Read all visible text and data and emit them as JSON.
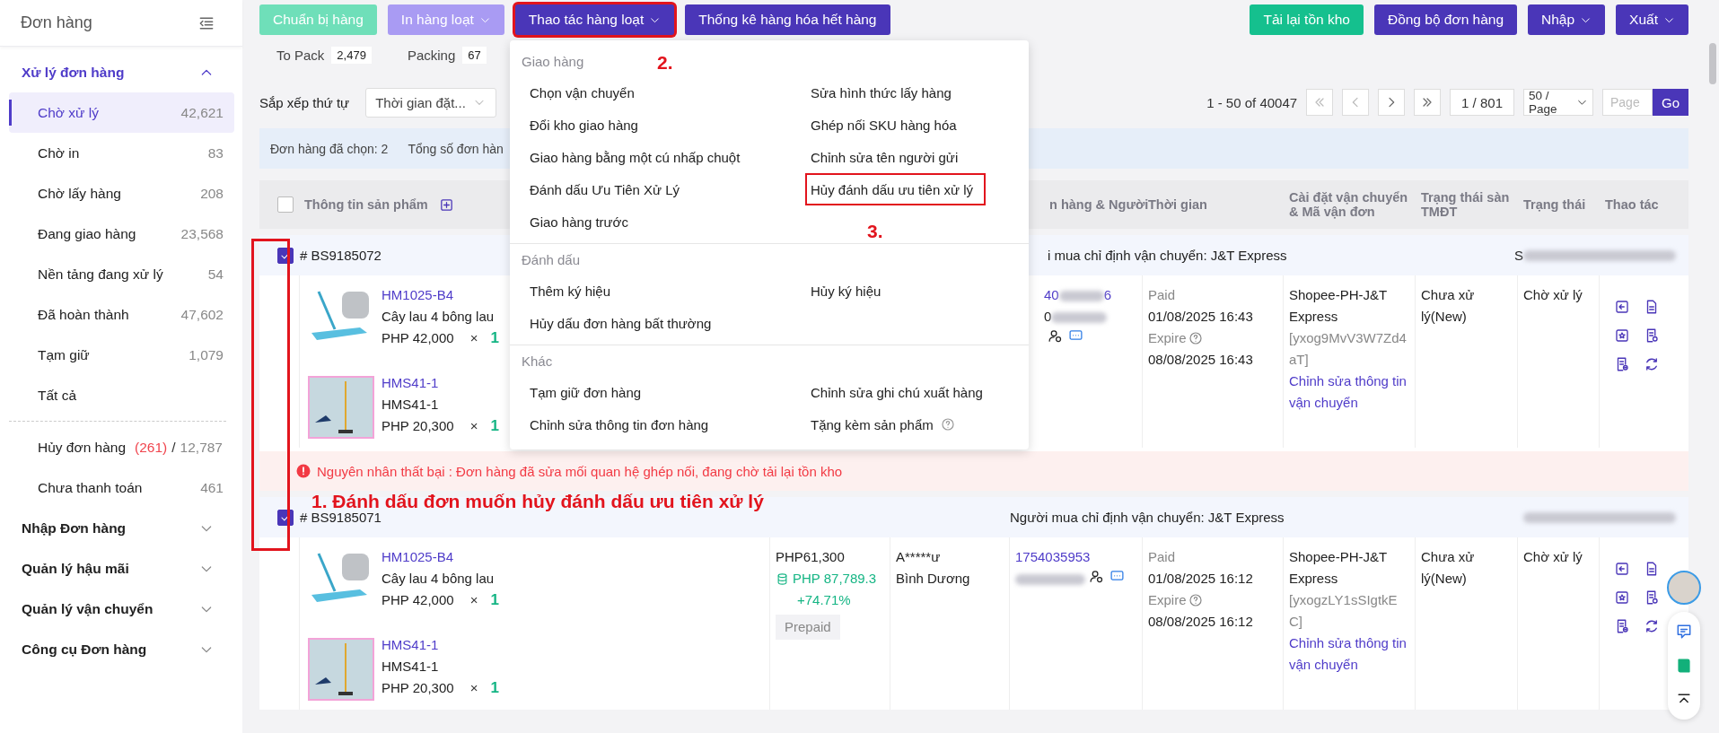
{
  "sidebar": {
    "title": "Đơn hàng",
    "sections": [
      {
        "label": "Xử lý đơn hàng",
        "expanded": true,
        "groups": [
          {
            "items": [
              {
                "label": "Chờ xử lý",
                "count": "42,621",
                "selected": true
              },
              {
                "label": "Chờ in",
                "count": "83",
                "selected": false
              },
              {
                "label": "Chờ lấy hàng",
                "count": "208",
                "selected": false
              },
              {
                "label": "Đang giao hàng",
                "count": "23,568",
                "selected": false
              },
              {
                "label": "Nền tảng đang xử lý",
                "count": "54",
                "selected": false
              },
              {
                "label": "Đã hoàn thành",
                "count": "47,602",
                "selected": false
              },
              {
                "label": "Tạm giữ",
                "count": "1,079",
                "selected": false
              },
              {
                "label": "Tất cả",
                "selected": false
              }
            ]
          },
          {
            "items": [
              {
                "label": "Hủy đơn hàng",
                "alert_count": "(261)",
                "separator": "/",
                "count": "12,787",
                "selected": false
              },
              {
                "label": "Chưa thanh toán",
                "count": "461",
                "selected": false
              }
            ]
          }
        ]
      },
      {
        "label": "Nhập Đơn hàng",
        "expanded": false
      },
      {
        "label": "Quản lý hậu mãi",
        "expanded": false
      },
      {
        "label": "Quản lý vận chuyển",
        "expanded": false
      },
      {
        "label": "Công cụ Đơn hàng",
        "expanded": false
      }
    ]
  },
  "toolbar": {
    "left_buttons": [
      {
        "label": "Chuẩn bị hàng",
        "kind": "success",
        "disabled": true,
        "dropdown": false,
        "highlighted": false
      },
      {
        "label": "In hàng loạt",
        "kind": "primary",
        "disabled": true,
        "dropdown": true,
        "highlighted": false
      },
      {
        "label": "Thao tác hàng loạt",
        "kind": "primary",
        "disabled": false,
        "dropdown": true,
        "highlighted": true
      },
      {
        "label": "Thống kê hàng hóa hết hàng",
        "kind": "primary",
        "disabled": false,
        "dropdown": false,
        "highlighted": false
      }
    ],
    "right_buttons": [
      {
        "label": "Tải lại tồn kho",
        "kind": "success",
        "disabled": false,
        "dropdown": false,
        "highlighted": false
      },
      {
        "label": "Đồng bộ đơn hàng",
        "kind": "primary",
        "disabled": false,
        "dropdown": false,
        "highlighted": false
      },
      {
        "label": "Nhập",
        "kind": "primary",
        "disabled": false,
        "dropdown": true,
        "highlighted": false
      },
      {
        "label": "Xuất",
        "kind": "primary",
        "disabled": false,
        "dropdown": true,
        "highlighted": false
      }
    ]
  },
  "counters": [
    {
      "label": "To Pack",
      "value": "2,479"
    },
    {
      "label": "Packing",
      "value": "67"
    }
  ],
  "sort": {
    "label": "Sắp xếp thứ tự",
    "value": "Thời gian đặt..."
  },
  "pagination": {
    "range": "1 - 50 of 40047",
    "page": "1 / 801",
    "page_size": "50 / Page",
    "placeholder": "Page",
    "go": "Go"
  },
  "selection_bar": {
    "selected": "Đơn hàng đã chọn: 2",
    "total": "Tổng số đơn hàn"
  },
  "table": {
    "select_all": {
      "checked": false
    },
    "checkboxes_highlighted": true,
    "columns": [
      {
        "label": "Thông tin sản phẩm"
      },
      {
        "label": "n hàng & Người"
      },
      {
        "label": "Thời gian"
      },
      {
        "label": "Cài đặt vận chuyển & Mã vận đơn"
      },
      {
        "label": "Trạng thái sàn TMĐT"
      },
      {
        "label": "Trạng thái"
      },
      {
        "label": "Thao tác"
      }
    ],
    "orders": [
      {
        "checked": true,
        "number": "# BS9185072",
        "carrier_note": "i mua chỉ định vận chuyển: J&T Express",
        "shop": "S",
        "products": [
          {
            "sku": "HM1025-B4",
            "name": "Cây lau 4 bông lau",
            "price": "PHP 42,000",
            "times": "×",
            "qty": "1"
          },
          {
            "sku": "HMS41-1",
            "name": "HMS41-1",
            "price": "PHP 20,300",
            "times": "×",
            "qty": "1"
          }
        ],
        "order_id": "40",
        "order_id_end": "6",
        "buyer_id": "0",
        "paid_label": "Paid",
        "paid_time": "01/08/2025 16:43",
        "expire_label": "Expire",
        "expire_time": "08/08/2025 16:43",
        "carrier": "Shopee-PH-J&T Express",
        "tracking": "[yxog9MvV3W7Zd4aT]",
        "edit_link": "Chỉnh sửa thông tin vận chuyển",
        "marketplace_status": "Chưa xử lý(New)",
        "status": "Chờ xử lý",
        "error": "Nguyên nhân thất bại : Đơn hàng đã sửa mối quan hệ ghép nối, đang chờ tải lại tồn kho"
      },
      {
        "checked": true,
        "number": "# BS9185071",
        "carrier_note": "Người mua chỉ định vận chuyển: J&T Express",
        "products": [
          {
            "sku": "HM1025-B4",
            "name": "Cây lau 4 bông lau",
            "price": "PHP 42,000",
            "times": "×",
            "qty": "1"
          },
          {
            "sku": "HMS41-1",
            "name": "HMS41-1",
            "price": "PHP 20,300",
            "times": "×",
            "qty": "1"
          }
        ],
        "total": "PHP61,300",
        "cost": "PHP 87,789.3",
        "margin": "+74.71%",
        "payment": "Prepaid",
        "buyer": "A*****ư",
        "region": "Bình Dương",
        "order_id": "1754035953",
        "paid_label": "Paid",
        "paid_time": "01/08/2025 16:12",
        "expire_label": "Expire",
        "expire_time": "08/08/2025 16:12",
        "carrier": "Shopee-PH-J&T Express",
        "tracking": "[yxogzLY1sSIgtkEC]",
        "edit_link": "Chỉnh sửa thông tin vận chuyển",
        "marketplace_status": "Chưa xử lý(New)",
        "status": "Chờ xử lý"
      }
    ]
  },
  "bulk_menu": {
    "groups": [
      {
        "title": "Giao hàng",
        "items": [
          {
            "label": "Chọn vận chuyển",
            "highlighted": false
          },
          {
            "label": "Sửa hình thức lấy hàng",
            "highlighted": false
          },
          {
            "label": "Đổi kho giao hàng",
            "highlighted": false
          },
          {
            "label": "Ghép nối SKU hàng hóa",
            "highlighted": false
          },
          {
            "label": "Giao hàng bằng một cú nhấp chuột",
            "highlighted": false
          },
          {
            "label": "Chỉnh sửa tên người gửi",
            "highlighted": false
          },
          {
            "label": "Đánh dấu Ưu Tiên Xử Lý",
            "highlighted": false
          },
          {
            "label": "Hủy đánh dấu ưu tiên xử lý",
            "highlighted": true
          },
          {
            "label": "Giao hàng trước",
            "highlighted": false
          }
        ]
      },
      {
        "title": "Đánh dấu",
        "items": [
          {
            "label": "Thêm ký hiệu",
            "highlighted": false
          },
          {
            "label": "Hủy ký hiệu",
            "highlighted": false
          },
          {
            "label": "Hủy dấu đơn hàng bất thường",
            "highlighted": false
          }
        ]
      },
      {
        "title": "Khác",
        "items": [
          {
            "label": "Tạm giữ đơn hàng",
            "highlighted": false
          },
          {
            "label": "Chỉnh sửa ghi chú xuất hàng",
            "highlighted": false
          },
          {
            "label": "Chỉnh sửa thông tin đơn hàng",
            "highlighted": false
          },
          {
            "label": "Tặng kèm sản phẩm",
            "highlighted": false,
            "help": true
          }
        ]
      }
    ]
  },
  "annotations": [
    {
      "kind": "bulk_button",
      "label": "2."
    },
    {
      "kind": "menu_item",
      "label": "3."
    },
    {
      "kind": "checkboxes",
      "label": "1. Đánh dấu đơn muốn hủy đánh dấu ưu tiên xử lý"
    }
  ]
}
